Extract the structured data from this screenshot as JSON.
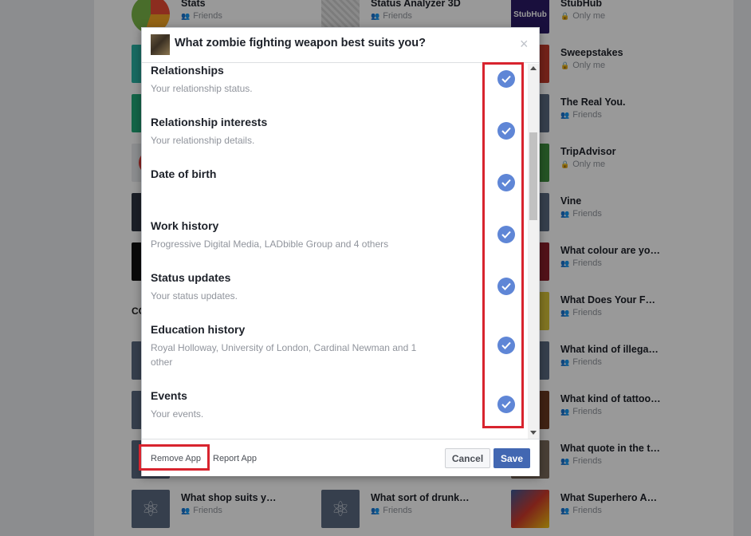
{
  "background": {
    "apps": [
      {
        "name": "Stats",
        "privacy": "Friends",
        "privacy_icon": "friends-icon",
        "thumb": "#f5a623"
      },
      {
        "name": "Status Analyzer 3D",
        "privacy": "Friends",
        "privacy_icon": "friends-icon",
        "thumb": "#dcdcdc"
      },
      {
        "name": "StubHub",
        "privacy": "Only me",
        "privacy_icon": "lock-icon",
        "thumb": "#2b1a66"
      },
      {
        "name": "Sweepstakes",
        "privacy": "Only me",
        "privacy_icon": "lock-icon",
        "thumb": "#c0392b"
      },
      {
        "name": "The Real You.",
        "privacy": "Friends",
        "privacy_icon": "friends-icon",
        "thumb": "#5b6a80"
      },
      {
        "name": "TripAdvisor",
        "privacy": "Only me",
        "privacy_icon": "lock-icon",
        "thumb": "#3f8c3f"
      },
      {
        "name": "Vine",
        "privacy": "Friends",
        "privacy_icon": "friends-icon",
        "thumb": "#5b6a80"
      },
      {
        "name": "What colour are yo…",
        "privacy": "Friends",
        "privacy_icon": "friends-icon",
        "thumb": "#8a1f2a"
      },
      {
        "name": "What Does Your F…",
        "privacy": "Friends",
        "privacy_icon": "friends-icon",
        "thumb": "#f1d54a"
      },
      {
        "name": "What kind of illega…",
        "privacy": "Friends",
        "privacy_icon": "friends-icon",
        "thumb": "#5b6a80"
      },
      {
        "name": "What kind of tattoo…",
        "privacy": "Friends",
        "privacy_icon": "friends-icon",
        "thumb": "#a0522d"
      },
      {
        "name": "What quote in the t…",
        "privacy": "Friends",
        "privacy_icon": "friends-icon",
        "thumb": "#7a6a5a"
      },
      {
        "name": "What shop suits y…",
        "privacy": "Friends",
        "privacy_icon": "friends-icon",
        "thumb": "#5b6a80"
      },
      {
        "name": "What sort of drunk…",
        "privacy": "Friends",
        "privacy_icon": "friends-icon",
        "thumb": "#5b6a80"
      },
      {
        "name": "What Superhero A…",
        "privacy": "Friends",
        "privacy_icon": "friends-icon",
        "thumb": "#3b5998"
      }
    ]
  },
  "modal": {
    "title": "What zombie fighting weapon best suits you?",
    "close_glyph": "×",
    "permissions": [
      {
        "title": "Relationships",
        "desc": "Your relationship status.",
        "checked": true
      },
      {
        "title": "Relationship interests",
        "desc": "Your relationship details.",
        "checked": true
      },
      {
        "title": "Date of birth",
        "desc": "",
        "checked": true
      },
      {
        "title": "Work history",
        "desc": "Progressive Digital Media, LADbible Group and 4 others",
        "checked": true
      },
      {
        "title": "Status updates",
        "desc": "Your status updates.",
        "checked": true
      },
      {
        "title": "Education history",
        "desc": "Royal Holloway, University of London, Cardinal Newman and 1 other",
        "checked": true
      },
      {
        "title": "Events",
        "desc": "Your events.",
        "checked": true
      }
    ],
    "footer": {
      "remove_label": "Remove App",
      "report_label": "Report App",
      "cancel_label": "Cancel",
      "save_label": "Save"
    }
  },
  "colors": {
    "accent": "#4267b2",
    "check": "#5f86d6",
    "highlight": "#d8242e"
  }
}
